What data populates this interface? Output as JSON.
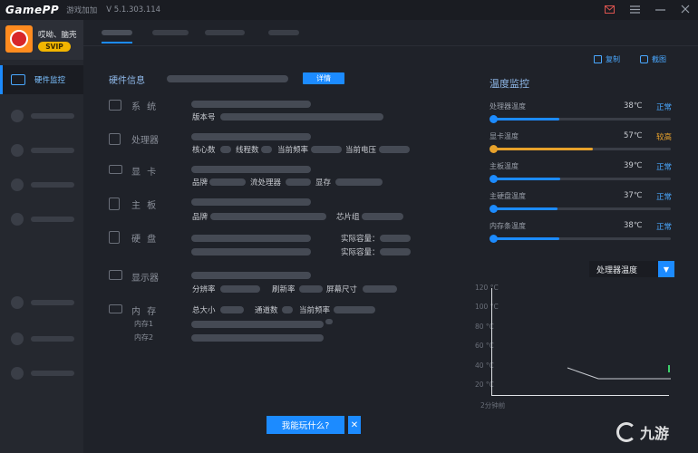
{
  "titlebar": {
    "app_name": "GamePP",
    "subtitle": "游戏加加",
    "version": "V 5.1.303.114"
  },
  "user": {
    "name": "哎呦、脑壳",
    "badge": "SVIP"
  },
  "sidebar": {
    "active_label": "硬件监控"
  },
  "actions": {
    "copy": "复制",
    "screenshot": "截图"
  },
  "hardware": {
    "title": "硬件信息",
    "detail_button": "详情",
    "system": {
      "label": "系 统",
      "field_version": "版本号"
    },
    "cpu": {
      "label": "处理器",
      "field_cores": "核心数",
      "field_threads": "线程数",
      "field_freq": "当前频率",
      "field_voltage": "当前电压"
    },
    "gpu": {
      "label": "显 卡",
      "field_brand": "品牌",
      "field_shaders": "流处理器",
      "field_vram": "显存"
    },
    "board": {
      "label": "主 板",
      "field_brand": "品牌",
      "field_chipset": "芯片组"
    },
    "disk": {
      "label": "硬 盘",
      "field_capacity_1": "实际容量：",
      "field_capacity_2": "实际容量："
    },
    "monitor": {
      "label": "显示器",
      "field_resolution": "分辨率",
      "field_refresh": "刷新率",
      "field_size": "屏幕尺寸"
    },
    "memory": {
      "label": "内 存",
      "field_total": "总大小",
      "field_channels": "通道数",
      "field_freq": "当前频率",
      "slot1": "内存1",
      "slot2": "内存2"
    }
  },
  "temperature": {
    "title": "温度监控",
    "items": [
      {
        "label": "处理器温度",
        "value": "38℃",
        "status": "正常",
        "level": 0.37
      },
      {
        "label": "显卡温度",
        "value": "57℃",
        "status": "较高",
        "level": 0.56
      },
      {
        "label": "主板温度",
        "value": "39℃",
        "status": "正常",
        "level": 0.38
      },
      {
        "label": "主硬盘温度",
        "value": "37℃",
        "status": "正常",
        "level": 0.36
      },
      {
        "label": "内存条温度",
        "value": "38℃",
        "status": "正常",
        "level": 0.37
      }
    ],
    "selected": "处理器温度",
    "y_ticks": [
      "120 °C",
      "100 °C",
      "80 °C",
      "60 °C",
      "40 °C",
      "20 °C"
    ],
    "x_label": "2分钟前"
  },
  "bottom": {
    "play_button": "我能玩什么?",
    "close": "✕",
    "watermark": "九游"
  },
  "colors": {
    "accent": "#1c8bff",
    "warm": "#e8a22b"
  }
}
